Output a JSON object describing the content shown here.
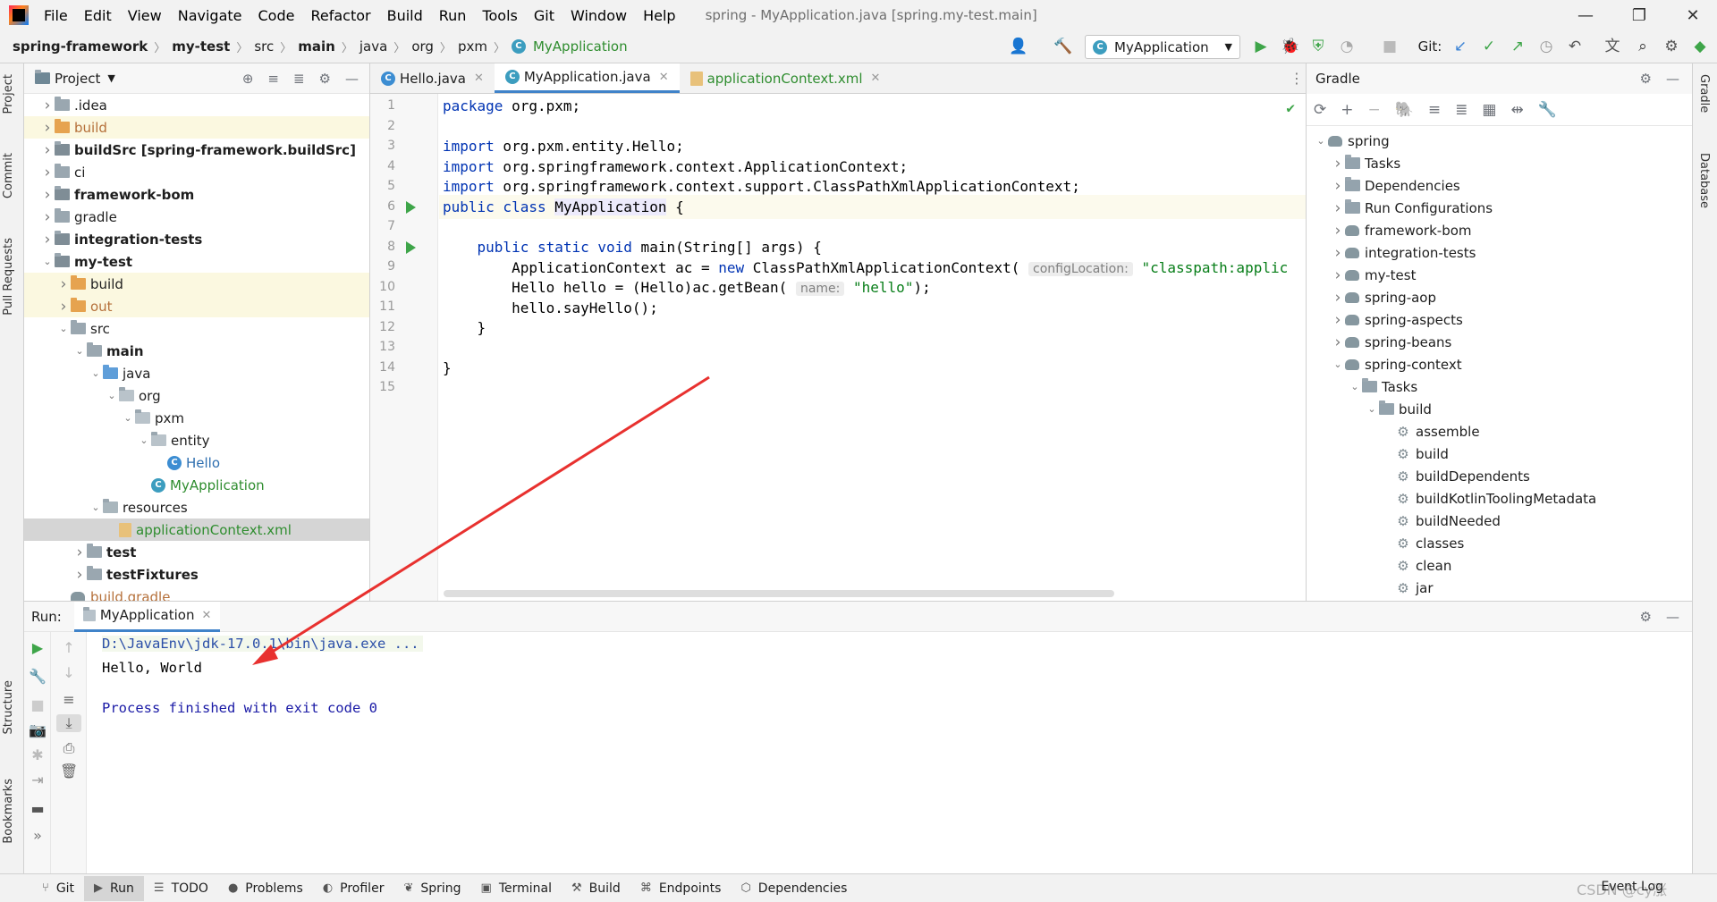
{
  "menubar": {
    "items": [
      "File",
      "Edit",
      "View",
      "Navigate",
      "Code",
      "Refactor",
      "Build",
      "Run",
      "Tools",
      "Git",
      "Window",
      "Help"
    ],
    "window_title": "spring - MyApplication.java [spring.my-test.main]"
  },
  "navbar": {
    "crumbs": [
      "spring-framework",
      "my-test",
      "src",
      "main",
      "java",
      "org",
      "pxm",
      "MyApplication"
    ],
    "run_config": "MyApplication",
    "git_label": "Git:"
  },
  "left_stripe": {
    "project": "Project",
    "commit": "Commit",
    "pull_requests": "Pull Requests",
    "structure": "Structure",
    "bookmarks": "Bookmarks"
  },
  "right_stripe": {
    "gradle": "Gradle",
    "database": "Database"
  },
  "project": {
    "title": "Project",
    "tree": [
      {
        "label": ".idea",
        "depth": 0,
        "arrow": "right",
        "icon": "folder"
      },
      {
        "label": "build",
        "depth": 0,
        "arrow": "right",
        "icon": "folder-orange",
        "style": "orange",
        "excluded": true
      },
      {
        "label": "buildSrc [spring-framework.buildSrc]",
        "depth": 0,
        "arrow": "right",
        "icon": "folder-module",
        "style": "bold"
      },
      {
        "label": "ci",
        "depth": 0,
        "arrow": "right",
        "icon": "folder"
      },
      {
        "label": "framework-bom",
        "depth": 0,
        "arrow": "right",
        "icon": "folder-module",
        "style": "bold"
      },
      {
        "label": "gradle",
        "depth": 0,
        "arrow": "right",
        "icon": "folder"
      },
      {
        "label": "integration-tests",
        "depth": 0,
        "arrow": "right",
        "icon": "folder-module",
        "style": "bold"
      },
      {
        "label": "my-test",
        "depth": 0,
        "arrow": "down",
        "icon": "folder-module",
        "style": "bold"
      },
      {
        "label": "build",
        "depth": 1,
        "arrow": "right",
        "icon": "folder-orange",
        "excluded": true
      },
      {
        "label": "out",
        "depth": 1,
        "arrow": "right",
        "icon": "folder-orange",
        "style": "orange",
        "excluded": true
      },
      {
        "label": "src",
        "depth": 1,
        "arrow": "down",
        "icon": "folder"
      },
      {
        "label": "main",
        "depth": 2,
        "arrow": "down",
        "icon": "folder",
        "style": "bold"
      },
      {
        "label": "java",
        "depth": 3,
        "arrow": "down",
        "icon": "folder-blue"
      },
      {
        "label": "org",
        "depth": 4,
        "arrow": "down",
        "icon": "folder-pkg"
      },
      {
        "label": "pxm",
        "depth": 5,
        "arrow": "down",
        "icon": "folder-pkg"
      },
      {
        "label": "entity",
        "depth": 6,
        "arrow": "down",
        "icon": "folder-pkg"
      },
      {
        "label": "Hello",
        "depth": 7,
        "arrow": "",
        "icon": "class",
        "style": "blue"
      },
      {
        "label": "MyApplication",
        "depth": 6,
        "arrow": "",
        "icon": "class-run",
        "style": "green"
      },
      {
        "label": "resources",
        "depth": 3,
        "arrow": "down",
        "icon": "folder-res"
      },
      {
        "label": "applicationContext.xml",
        "depth": 4,
        "arrow": "",
        "icon": "xml",
        "style": "green",
        "selected": true
      },
      {
        "label": "test",
        "depth": 2,
        "arrow": "right",
        "icon": "folder",
        "style": "bold"
      },
      {
        "label": "testFixtures",
        "depth": 2,
        "arrow": "right",
        "icon": "folder",
        "style": "bold"
      },
      {
        "label": "build.gradle",
        "depth": 1,
        "arrow": "",
        "icon": "gradle",
        "style": "orange"
      }
    ]
  },
  "editor": {
    "tabs": [
      {
        "label": "Hello.java",
        "active": false,
        "icon": "class"
      },
      {
        "label": "MyApplication.java",
        "active": true,
        "icon": "class-run"
      },
      {
        "label": "applicationContext.xml",
        "active": false,
        "icon": "xml"
      }
    ],
    "line_numbers": [
      "1",
      "2",
      "3",
      "4",
      "5",
      "6",
      "7",
      "8",
      "9",
      "10",
      "11",
      "12",
      "13",
      "14",
      "15"
    ],
    "code": {
      "l1_kw": "package",
      "l1_rest": " org.pxm;",
      "l3_kw": "import",
      "l3_rest": " org.pxm.entity.Hello;",
      "l4_kw": "import",
      "l4_rest": " org.springframework.context.ApplicationContext;",
      "l5_kw": "import",
      "l5_rest": " org.springframework.context.support.ClassPathXmlApplicationContext;",
      "l7_kw": "public class",
      "l7_name": "MyApplication",
      "l7_rest": " {",
      "l9_kw": "    public static void",
      "l9_rest": " main(String[] args) {",
      "l10_a": "        ApplicationContext ac = ",
      "l10_kw": "new",
      "l10_b": " ClassPathXmlApplicationContext(",
      "l10_hint": "configLocation:",
      "l10_str": "\"classpath:applic",
      "l11_a": "        Hello hello = (Hello)ac.getBean(",
      "l11_hint": "name:",
      "l11_str": "\"hello\"",
      "l11_b": ");",
      "l12": "        hello.sayHello();",
      "l13": "    }",
      "l15": "}"
    }
  },
  "gradle": {
    "title": "Gradle",
    "tree": [
      {
        "label": "spring",
        "depth": 0,
        "arrow": "down",
        "icon": "gradle"
      },
      {
        "label": "Tasks",
        "depth": 1,
        "arrow": "right",
        "icon": "folder-gear"
      },
      {
        "label": "Dependencies",
        "depth": 1,
        "arrow": "right",
        "icon": "folder-dep"
      },
      {
        "label": "Run Configurations",
        "depth": 1,
        "arrow": "right",
        "icon": "folder-gear"
      },
      {
        "label": "framework-bom",
        "depth": 1,
        "arrow": "right",
        "icon": "gradle"
      },
      {
        "label": "integration-tests",
        "depth": 1,
        "arrow": "right",
        "icon": "gradle"
      },
      {
        "label": "my-test",
        "depth": 1,
        "arrow": "right",
        "icon": "gradle"
      },
      {
        "label": "spring-aop",
        "depth": 1,
        "arrow": "right",
        "icon": "gradle"
      },
      {
        "label": "spring-aspects",
        "depth": 1,
        "arrow": "right",
        "icon": "gradle"
      },
      {
        "label": "spring-beans",
        "depth": 1,
        "arrow": "right",
        "icon": "gradle"
      },
      {
        "label": "spring-context",
        "depth": 1,
        "arrow": "down",
        "icon": "gradle"
      },
      {
        "label": "Tasks",
        "depth": 2,
        "arrow": "down",
        "icon": "folder-gear"
      },
      {
        "label": "build",
        "depth": 3,
        "arrow": "down",
        "icon": "folder-gear"
      },
      {
        "label": "assemble",
        "depth": 4,
        "arrow": "",
        "icon": "gear"
      },
      {
        "label": "build",
        "depth": 4,
        "arrow": "",
        "icon": "gear"
      },
      {
        "label": "buildDependents",
        "depth": 4,
        "arrow": "",
        "icon": "gear"
      },
      {
        "label": "buildKotlinToolingMetadata",
        "depth": 4,
        "arrow": "",
        "icon": "gear"
      },
      {
        "label": "buildNeeded",
        "depth": 4,
        "arrow": "",
        "icon": "gear"
      },
      {
        "label": "classes",
        "depth": 4,
        "arrow": "",
        "icon": "gear"
      },
      {
        "label": "clean",
        "depth": 4,
        "arrow": "",
        "icon": "gear"
      },
      {
        "label": "jar",
        "depth": 4,
        "arrow": "",
        "icon": "gear"
      }
    ]
  },
  "run": {
    "label": "Run:",
    "tab": "MyApplication",
    "console": {
      "cmd": "D:\\JavaEnv\\jdk-17.0.1\\bin\\java.exe ...",
      "output": "Hello, World",
      "exit": "Process finished with exit code 0"
    }
  },
  "bottom_bar": {
    "tabs": [
      {
        "label": "Git",
        "icon": "git-icon",
        "active": false
      },
      {
        "label": "Run",
        "icon": "run-icon",
        "active": true
      },
      {
        "label": "TODO",
        "icon": "todo-icon",
        "active": false
      },
      {
        "label": "Problems",
        "icon": "problems-icon",
        "active": false
      },
      {
        "label": "Profiler",
        "icon": "profiler-icon",
        "active": false
      },
      {
        "label": "Spring",
        "icon": "spring-icon",
        "active": false
      },
      {
        "label": "Terminal",
        "icon": "terminal-icon",
        "active": false
      },
      {
        "label": "Build",
        "icon": "build-icon",
        "active": false
      },
      {
        "label": "Endpoints",
        "icon": "endpoints-icon",
        "active": false
      },
      {
        "label": "Dependencies",
        "icon": "dependencies-icon",
        "active": false
      }
    ],
    "event_log": "Event Log",
    "watermark": "CSDN @cy涨"
  },
  "colors": {
    "accent": "#4083c9",
    "run_green": "#3ea549",
    "annotation_red": "#e8312f"
  }
}
